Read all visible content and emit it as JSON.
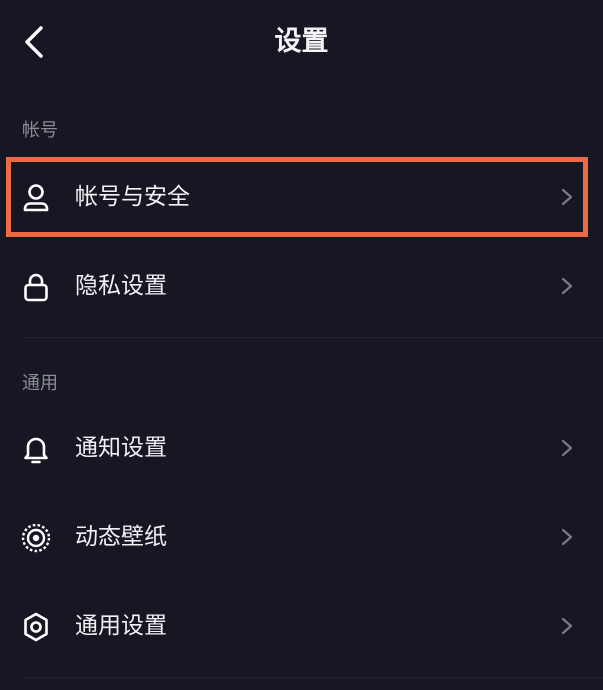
{
  "header": {
    "title": "设置",
    "back_icon": "chevron-left-icon"
  },
  "sections": [
    {
      "label": "帐号",
      "items": [
        {
          "label": "帐号与安全",
          "icon": "user-icon",
          "highlighted": true
        },
        {
          "label": "隐私设置",
          "icon": "lock-icon"
        }
      ]
    },
    {
      "label": "通用",
      "items": [
        {
          "label": "通知设置",
          "icon": "bell-icon"
        },
        {
          "label": "动态壁纸",
          "icon": "live-wallpaper-icon"
        },
        {
          "label": "通用设置",
          "icon": "gear-icon"
        }
      ]
    }
  ],
  "colors": {
    "background": "#161722",
    "highlight_border": "#ee6a43",
    "section_label": "#8b8c95",
    "text": "#f2f2f4",
    "chevron": "#7a7b84"
  }
}
